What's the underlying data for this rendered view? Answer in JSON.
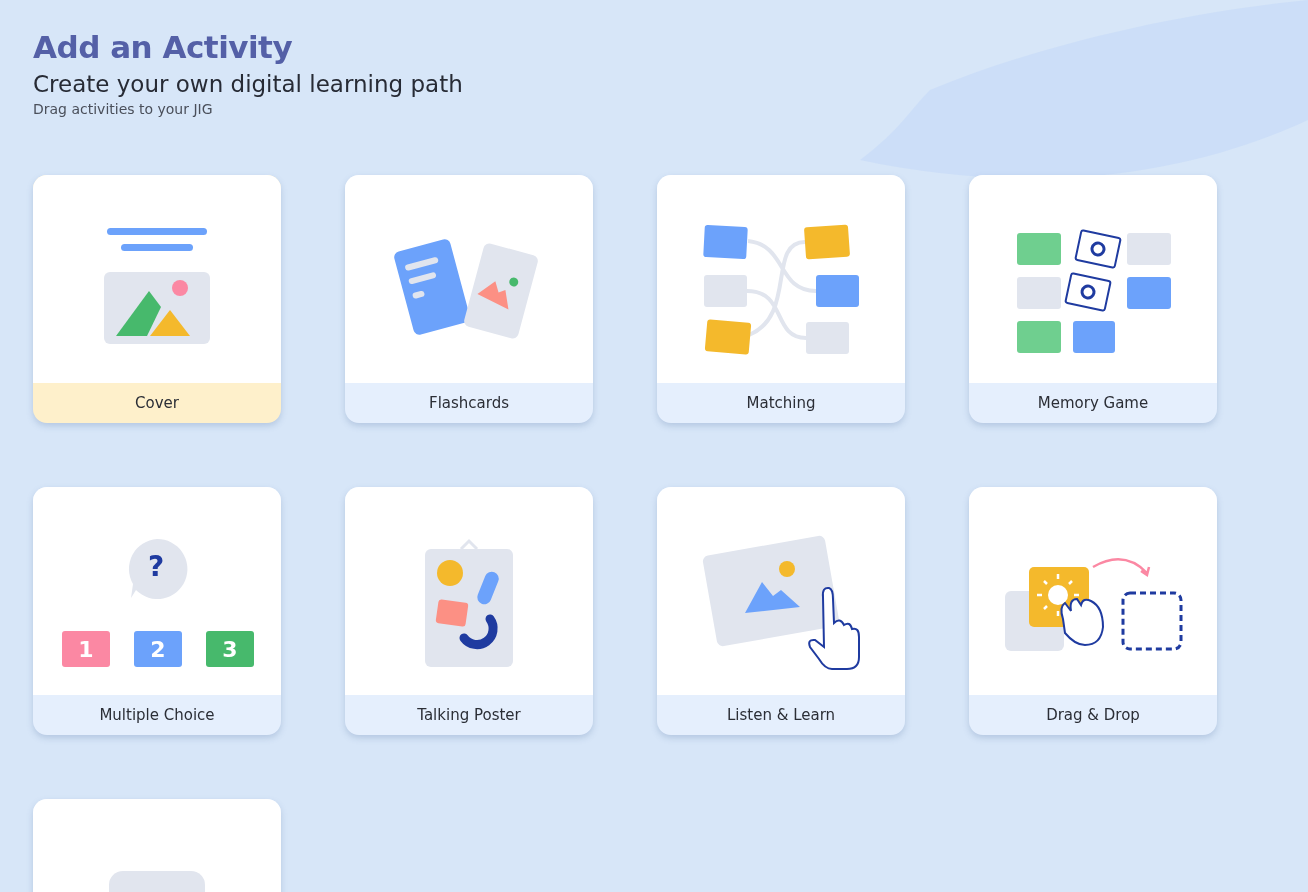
{
  "header": {
    "title": "Add an Activity",
    "subtitle": "Create your own digital learning path",
    "hint": "Drag activities to your JIG"
  },
  "activities": [
    {
      "kind": "cover",
      "label": "Cover",
      "selected": true
    },
    {
      "kind": "flashcards",
      "label": "Flashcards",
      "selected": false
    },
    {
      "kind": "matching",
      "label": "Matching",
      "selected": false
    },
    {
      "kind": "memory",
      "label": "Memory Game",
      "selected": false
    },
    {
      "kind": "multiple-choice",
      "label": "Multiple Choice",
      "selected": false,
      "question_mark": "?",
      "options": [
        "1",
        "2",
        "3"
      ]
    },
    {
      "kind": "poster",
      "label": "Talking Poster",
      "selected": false
    },
    {
      "kind": "listen",
      "label": "Listen & Learn",
      "selected": false
    },
    {
      "kind": "drag-drop",
      "label": "Drag & Drop",
      "selected": false
    },
    {
      "kind": "partial"
    }
  ]
}
